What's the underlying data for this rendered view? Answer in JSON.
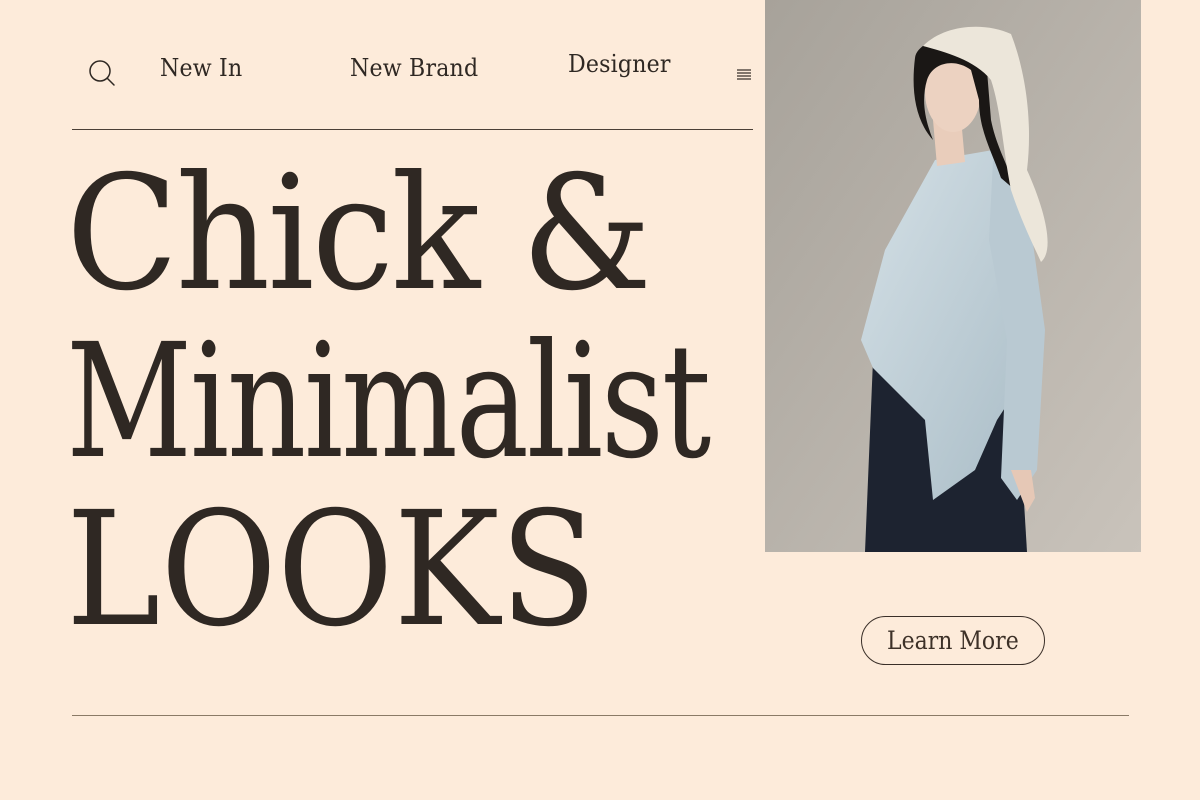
{
  "nav": {
    "links": [
      "New In",
      "New Brand",
      "Designer"
    ]
  },
  "hero": {
    "headline_lines": [
      "Chick &",
      "Minimalist",
      "LOOKS"
    ],
    "cta_label": "Learn More"
  },
  "icons": {
    "search": "search-icon",
    "menu": "menu-icon"
  },
  "colors": {
    "background": "#fdebda",
    "text": "#2f2823",
    "rule": "#4a3f36"
  }
}
